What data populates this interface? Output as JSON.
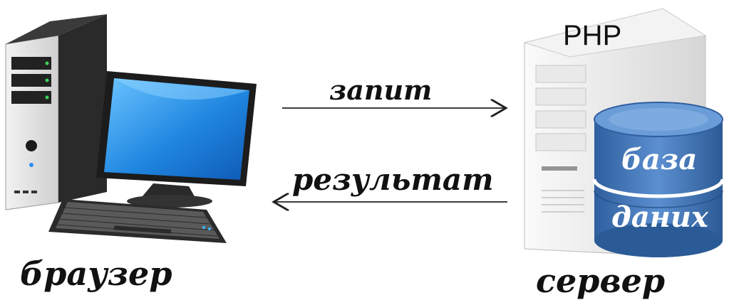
{
  "labels": {
    "client": "браузер",
    "server": "сервер",
    "request": "запит",
    "result": "результат",
    "server_tech": "PHP",
    "database_line1": "база",
    "database_line2": "даних"
  },
  "icons": {
    "client": "desktop-computer-icon",
    "server": "server-tower-icon",
    "database": "database-cylinder-icon"
  },
  "colors": {
    "database": "#3b6fb0",
    "monitor_screen": "#1a7fd6",
    "tower": "#2b2b2b",
    "server_case": "#e6e6e6"
  }
}
